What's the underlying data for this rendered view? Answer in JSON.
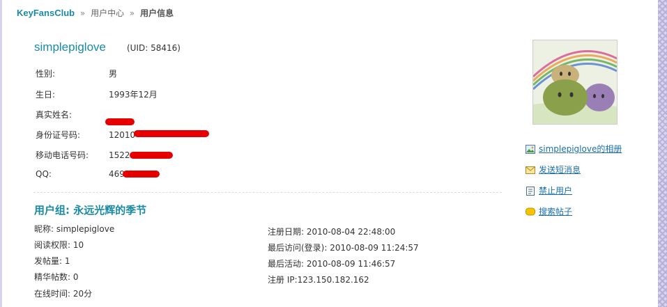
{
  "breadcrumb": {
    "site": "KeyFansClub",
    "sep": "»",
    "user_center": "用户中心",
    "current": "用户信息"
  },
  "profile": {
    "username": "simplepiglove",
    "uid": "(UID: 58416)",
    "gender_label": "性别:",
    "gender": "男",
    "birthday_label": "生日:",
    "birthday": "1993年12月",
    "realname_label": "真实姓名:",
    "idcard_label": "身份证号码:",
    "idcard_visible": "12010",
    "mobile_label": "移动电话号码:",
    "mobile_visible": "1522",
    "qq_label": "QQ:",
    "qq_visible": "469"
  },
  "group": {
    "title": "用户组: 永远光辉的季节"
  },
  "stats_left": [
    "昵称: simplepiglove",
    "阅读权限: 10",
    "发帖量: 1",
    "精华帖数: 0",
    "在线时间: 20分"
  ],
  "stats_right": [
    "注册日期: 2010-08-04 22:48:00",
    "最后访问(登录): 2010-08-09 11:24:57",
    "最后活动: 2010-08-09 11:46:57",
    "注册 IP:123.150.182.162"
  ],
  "sidebar": {
    "album": "simplepiglove的相册",
    "message": "发送短消息",
    "ban": "禁止用户",
    "search_posts": "搜索帖子"
  },
  "colors": {
    "link": "#1a8aa4",
    "redaction": "#e60000"
  }
}
